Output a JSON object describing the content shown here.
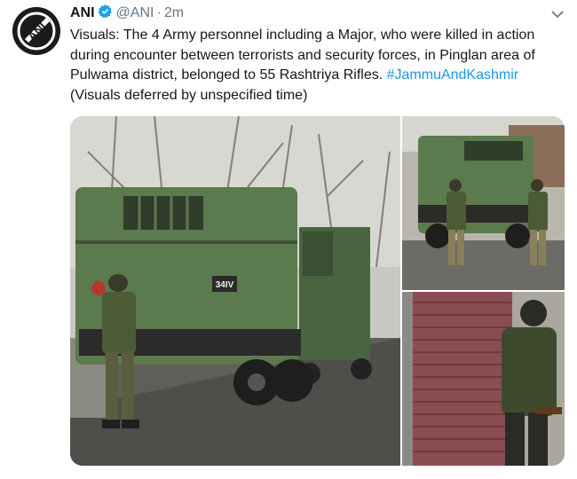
{
  "tweet": {
    "display_name": "ANI",
    "handle": "@ANI",
    "separator": "·",
    "timestamp": "2m",
    "text_before": "Visuals: The 4 Army personnel including a Major, who were killed in action during encounter between terrorists and security forces, in Pinglan area of Pulwama district, belonged to 55 Rashtriya Rifles. ",
    "hashtag": "#JammuAndKashmir",
    "text_after": " (Visuals deferred by unspecified time)",
    "avatar_logo": "ANI",
    "vehicle_plate": "34IV"
  },
  "icons": {
    "verified": "verified-badge-icon",
    "caret": "chevron-down-icon"
  },
  "colors": {
    "link": "#1b95e0",
    "name": "#14171a",
    "meta": "#657786",
    "verified": "#1da1f2",
    "truck_green": "#5b7a4e"
  }
}
